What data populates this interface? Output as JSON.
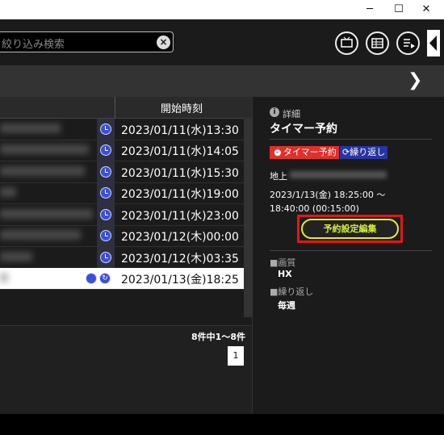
{
  "search": {
    "placeholder": "絞り込み検索",
    "clear_icon": "×"
  },
  "window": {
    "minimize": "─",
    "maximize": "☐",
    "close": "✕"
  },
  "toolbar": {
    "icons": [
      "tv-icon",
      "epg-icon",
      "playlist-icon"
    ]
  },
  "nav": {
    "chevron": "❯"
  },
  "list": {
    "column_header": "開始時刻",
    "rows": [
      {
        "time": "2023/01/11(水)13:30",
        "icons": [
          "clock"
        ],
        "selected": false
      },
      {
        "time": "2023/01/11(水)14:05",
        "icons": [
          "clock"
        ],
        "selected": false
      },
      {
        "time": "2023/01/11(水)15:30",
        "icons": [
          "clock"
        ],
        "selected": false
      },
      {
        "time": "2023/01/11(水)19:00",
        "icons": [
          "clock"
        ],
        "selected": false
      },
      {
        "time": "2023/01/11(水)23:00",
        "icons": [
          "clock"
        ],
        "selected": false
      },
      {
        "time": "2023/01/12(木)00:00",
        "icons": [
          "clock"
        ],
        "selected": false
      },
      {
        "time": "2023/01/12(木)03:35",
        "icons": [
          "clock"
        ],
        "selected": false
      },
      {
        "time": "2023/01/13(金)18:25",
        "icons": [
          "alarm",
          "repeat"
        ],
        "selected": true
      }
    ],
    "count": "8件中1～8件",
    "page": "1"
  },
  "detail": {
    "section_label": "詳細",
    "info_icon": "i",
    "title": "タイマー予約",
    "badge_timer": "タイマー予約",
    "badge_repeat": "繰り返し",
    "channel_prefix": "地上",
    "datetime": "2023/1/13(金) 18:25:00 ～\n18:40:00 (00:15:00)",
    "edit_button": "予約設定編集",
    "quality_label": "■画質",
    "quality_value": "HX",
    "repeat_label": "■繰り返し",
    "repeat_value": "毎週"
  },
  "colors": {
    "accent_yellow": "#d8ee3a",
    "highlight_red": "#e01818",
    "timer_red": "#e0302a",
    "repeat_blue": "#2834a0"
  }
}
